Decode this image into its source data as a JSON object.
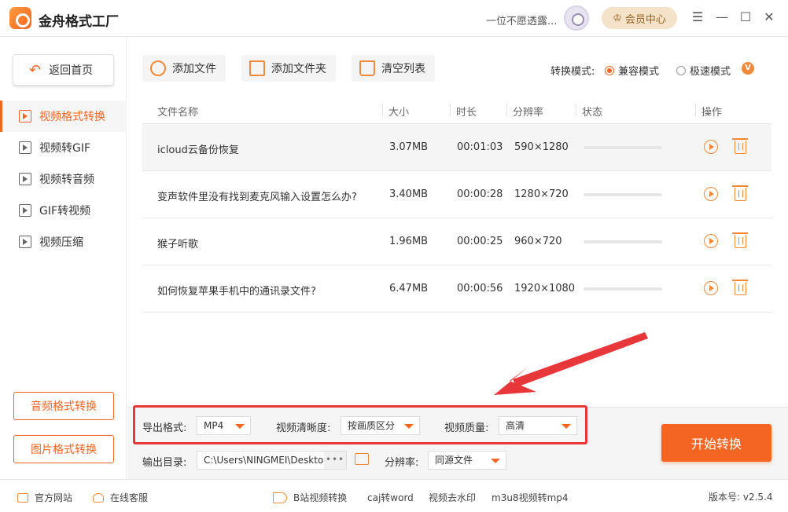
{
  "window": {
    "app_title": "金舟格式工厂",
    "user_name": "一位不愿透露...",
    "vip_label": "会员中心"
  },
  "sidebar": {
    "back_label": "返回首页",
    "items": [
      {
        "label": "视频格式转换",
        "icon": "video-convert-icon",
        "active": true
      },
      {
        "label": "视频转GIF",
        "icon": "image-icon",
        "active": false
      },
      {
        "label": "视频转音频",
        "icon": "music-icon",
        "active": false
      },
      {
        "label": "GIF转视频",
        "icon": "play-icon",
        "active": false
      },
      {
        "label": "视频压缩",
        "icon": "compress-icon",
        "active": false
      }
    ],
    "audio_convert_label": "音频格式转换",
    "image_convert_label": "图片格式转换"
  },
  "toolbar": {
    "add_file_label": "添加文件",
    "add_folder_label": "添加文件夹",
    "clear_list_label": "清空列表",
    "mode_label": "转换模式:",
    "mode_options": [
      "兼容模式",
      "极速模式"
    ],
    "mode_selected": "兼容模式",
    "vip_badge": "V"
  },
  "table": {
    "headers": [
      "文件名称",
      "大小",
      "时长",
      "分辨率",
      "状态",
      "操作"
    ],
    "rows": [
      {
        "name": "icloud云备份恢复",
        "size": "3.07MB",
        "duration": "00:01:03",
        "resolution": "590×1280",
        "progress": 0
      },
      {
        "name": "变声软件里没有找到麦克风输入设置怎么办?",
        "size": "3.40MB",
        "duration": "00:00:28",
        "resolution": "1280×720",
        "progress": 0
      },
      {
        "name": "猴子听歌",
        "size": "1.96MB",
        "duration": "00:00:25",
        "resolution": "960×720",
        "progress": 0
      },
      {
        "name": "如何恢复苹果手机中的通讯录文件?",
        "size": "6.47MB",
        "duration": "00:00:56",
        "resolution": "1920×1080",
        "progress": 0
      }
    ]
  },
  "settings": {
    "export_format_label": "导出格式:",
    "export_format_value": "MP4",
    "clarity_label": "视频清晰度:",
    "clarity_value": "按画质区分",
    "quality_label": "视频质量:",
    "quality_value": "高清",
    "output_dir_label": "输出目录:",
    "output_dir_value": "C:\\Users\\NINGMEI\\Deskto",
    "more_label": "•••",
    "resolution_label": "分辨率:",
    "resolution_value": "同源文件",
    "start_label": "开始转换",
    "highlight_color": "#e8373a",
    "accent_color": "#f26522"
  },
  "statusbar": {
    "website_label": "官方网站",
    "support_label": "在线客服",
    "links": [
      "B站视频转换",
      "caj转word",
      "视频去水印",
      "m3u8视频转mp4"
    ],
    "version": "版本号: v2.5.4"
  }
}
